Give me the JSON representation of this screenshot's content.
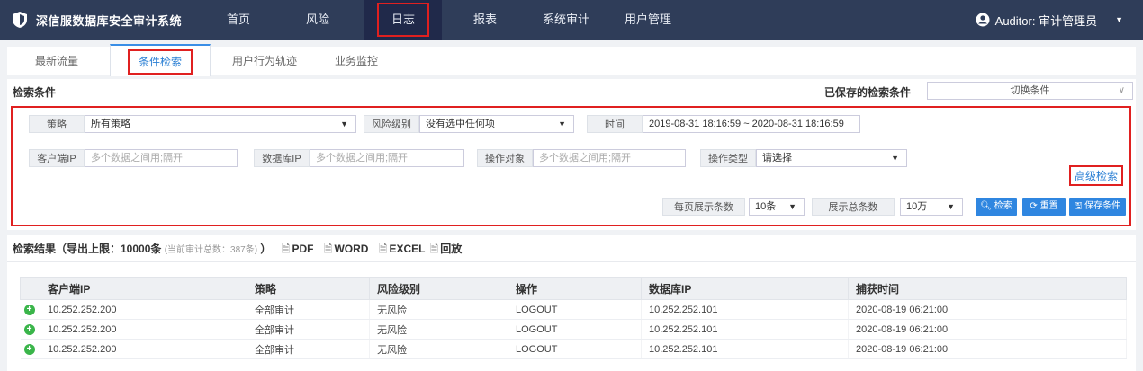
{
  "app": {
    "title": "深信服数据库安全审计系统"
  },
  "nav": {
    "items": [
      "首页",
      "风险",
      "日志",
      "报表",
      "系统审计",
      "用户管理"
    ],
    "active": "日志",
    "user": "Auditor: 审计管理员"
  },
  "tabs": {
    "items": [
      "最新流量",
      "条件检索",
      "用户行为轨迹",
      "业务监控"
    ],
    "active": "条件检索"
  },
  "search": {
    "title": "检索条件",
    "saved_label": "已保存的检索条件",
    "saved_select": "切换条件",
    "policy_label": "策略",
    "policy_value": "所有策略",
    "risk_label": "风险级别",
    "risk_value": "没有选中任何项",
    "time_label": "时间",
    "time_value": "2019-08-31 18:16:59 ~ 2020-08-31 18:16:59",
    "client_ip_label": "客户端IP",
    "client_ip_placeholder": "多个数据之间用;隔开",
    "db_ip_label": "数据库IP",
    "db_ip_placeholder": "多个数据之间用;隔开",
    "object_label": "操作对象",
    "object_placeholder": "多个数据之间用;隔开",
    "optype_label": "操作类型",
    "optype_value": "请选择",
    "advanced": "高级检索",
    "per_page_label": "每页展示条数",
    "per_page_value": "10条",
    "total_label": "展示总条数",
    "total_value": "10万",
    "btn_search": "检索",
    "btn_reset": "重置",
    "btn_save": "保存条件"
  },
  "results": {
    "title": "检索结果（导出上限：10000条",
    "count_note": "(当前审计总数：387条)",
    "title_close": "）",
    "export_pdf": "PDF",
    "export_word": "WORD",
    "export_excel": "EXCEL",
    "replay": "回放",
    "columns": [
      "客户端IP",
      "策略",
      "风险级别",
      "操作",
      "数据库IP",
      "捕获时间"
    ],
    "rows": [
      [
        "10.252.252.200",
        "全部审计",
        "无风险",
        "LOGOUT",
        "10.252.252.101",
        "2020-08-19 06:21:00"
      ],
      [
        "10.252.252.200",
        "全部审计",
        "无风险",
        "LOGOUT",
        "10.252.252.101",
        "2020-08-19 06:21:00"
      ],
      [
        "10.252.252.200",
        "全部审计",
        "无风险",
        "LOGOUT",
        "10.252.252.101",
        "2020-08-19 06:21:00"
      ]
    ]
  },
  "colors": {
    "nav_bg": "#2f3d59",
    "accent": "#2f86e0",
    "highlight": "#e02020",
    "expand": "#3ab54a"
  }
}
